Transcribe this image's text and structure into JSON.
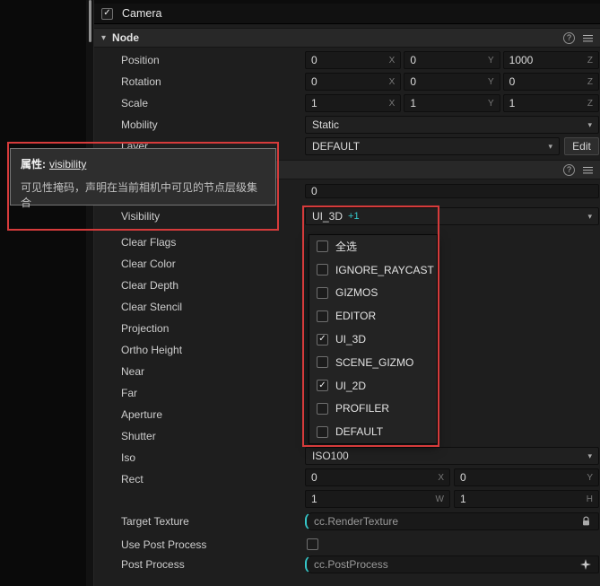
{
  "colors": {
    "annotation_red": "#d63b3b",
    "asset_accent": "#35c7c9"
  },
  "header": {
    "title": "Camera",
    "checked": true
  },
  "node_section": {
    "title": "Node"
  },
  "transform": {
    "position": {
      "label": "Position",
      "fields": [
        {
          "value": "0",
          "axis": "X"
        },
        {
          "value": "0",
          "axis": "Y"
        },
        {
          "value": "1000",
          "axis": "Z"
        }
      ]
    },
    "rotation": {
      "label": "Rotation",
      "fields": [
        {
          "value": "0",
          "axis": "X"
        },
        {
          "value": "0",
          "axis": "Y"
        },
        {
          "value": "0",
          "axis": "Z"
        }
      ]
    },
    "scale": {
      "label": "Scale",
      "fields": [
        {
          "value": "1",
          "axis": "X"
        },
        {
          "value": "1",
          "axis": "Y"
        },
        {
          "value": "1",
          "axis": "Z"
        }
      ]
    },
    "mobility": {
      "label": "Mobility",
      "value": "Static"
    },
    "layer": {
      "label": "Layer",
      "value": "DEFAULT",
      "edit_label": "Edit"
    }
  },
  "camera_component": {
    "priority_value": "0",
    "visibility": {
      "label": "Visibility",
      "value": "UI_3D",
      "badge": "+1"
    },
    "prop_labels": [
      "Clear Flags",
      "Clear Color",
      "Clear Depth",
      "Clear Stencil",
      "Projection",
      "Ortho Height",
      "Near",
      "Far",
      "Aperture",
      "Shutter",
      "Iso",
      "Rect"
    ],
    "iso_value": "ISO100",
    "rect_row1": [
      {
        "value": "0",
        "axis": "X"
      },
      {
        "value": "0",
        "axis": "Y"
      }
    ],
    "rect_row2": [
      {
        "value": "1",
        "axis": "W"
      },
      {
        "value": "1",
        "axis": "H"
      }
    ],
    "target_texture": {
      "label": "Target Texture",
      "value": "cc.RenderTexture"
    },
    "use_post_process": {
      "label": "Use Post Process",
      "checked": false
    },
    "post_process": {
      "label": "Post Process",
      "value": "cc.PostProcess"
    }
  },
  "tooltip": {
    "prefix": "属性:",
    "property": "visibility",
    "description": "可见性掩码，声明在当前相机中可见的节点层级集合"
  },
  "visibility_dropdown": {
    "items": [
      {
        "label": "全选",
        "checked": false
      },
      {
        "label": "IGNORE_RAYCAST",
        "checked": false
      },
      {
        "label": "GIZMOS",
        "checked": false
      },
      {
        "label": "EDITOR",
        "checked": false
      },
      {
        "label": "UI_3D",
        "checked": true
      },
      {
        "label": "SCENE_GIZMO",
        "checked": false
      },
      {
        "label": "UI_2D",
        "checked": true
      },
      {
        "label": "PROFILER",
        "checked": false
      },
      {
        "label": "DEFAULT",
        "checked": false
      }
    ]
  }
}
